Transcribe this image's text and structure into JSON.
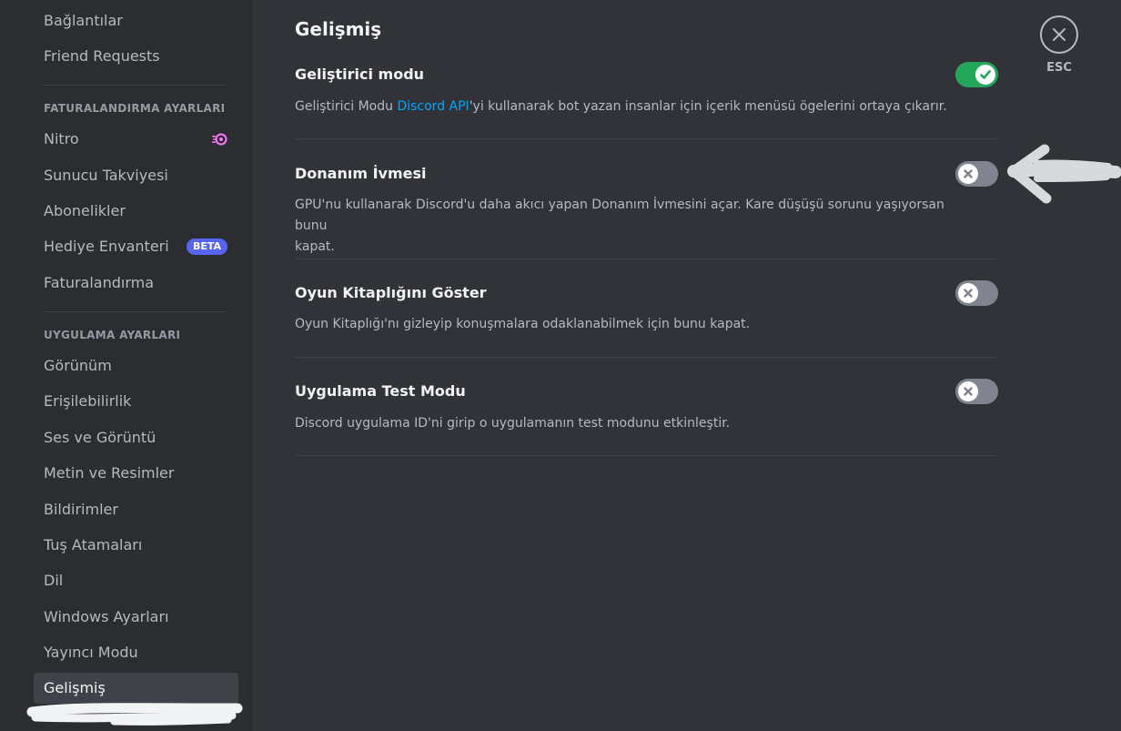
{
  "sidebar": {
    "items_top": [
      {
        "label": "Bağlantılar"
      },
      {
        "label": "Friend Requests"
      }
    ],
    "billing_header": "FATURALANDIRMA AYARLARI",
    "billing_items": [
      {
        "label": "Nitro"
      },
      {
        "label": "Sunucu Takviyesi"
      },
      {
        "label": "Abonelikler"
      },
      {
        "label": "Hediye Envanteri",
        "badge": "BETA"
      },
      {
        "label": "Faturalandırma"
      }
    ],
    "app_header": "UYGULAMA AYARLARI",
    "app_items": [
      {
        "label": "Görünüm"
      },
      {
        "label": "Erişilebilirlik"
      },
      {
        "label": "Ses ve Görüntü"
      },
      {
        "label": "Metin ve Resimler"
      },
      {
        "label": "Bildirimler"
      },
      {
        "label": "Tuş Atamaları"
      },
      {
        "label": "Dil"
      },
      {
        "label": "Windows Ayarları"
      },
      {
        "label": "Yayıncı Modu"
      },
      {
        "label": "Gelişmiş",
        "selected": true
      }
    ]
  },
  "main": {
    "title": "Gelişmiş",
    "settings": [
      {
        "title": "Geliştirici modu",
        "desc_pre": "Geliştirici Modu ",
        "desc_link": "Discord API",
        "desc_post": "'yi kullanarak bot yazan insanlar için içerik menüsü ögelerini ortaya çıkarır.",
        "enabled": true
      },
      {
        "title": "Donanım İvmesi",
        "desc_line1": "GPU'nu kullanarak Discord'u daha akıcı yapan Donanım İvmesini açar. Kare düşüşü sorunu yaşıyorsan bunu",
        "desc_line2": "kapat.",
        "enabled": false
      },
      {
        "title": "Oyun Kitaplığını Göster",
        "desc": "Oyun Kitaplığı'nı gizleyip konuşmalara odaklanabilmek için bunu kapat.",
        "enabled": false
      },
      {
        "title": "Uygulama Test Modu",
        "desc": "Discord uygulama ID'ni girip o uygulamanın test modunu etkinleştir.",
        "enabled": false
      }
    ]
  },
  "close": {
    "esc_label": "ESC"
  },
  "colors": {
    "sidebar_bg": "#2b2d31",
    "main_bg": "#313338",
    "toggle_on": "#23a55a",
    "toggle_off": "#80848e",
    "link": "#00a8fc",
    "beta_badge": "#5865f2",
    "nitro_icon": "#ff73fa"
  },
  "icons": {
    "nitro": "nitro-icon",
    "close": "close-icon",
    "toggle_on": "check-icon",
    "toggle_off": "x-icon"
  }
}
